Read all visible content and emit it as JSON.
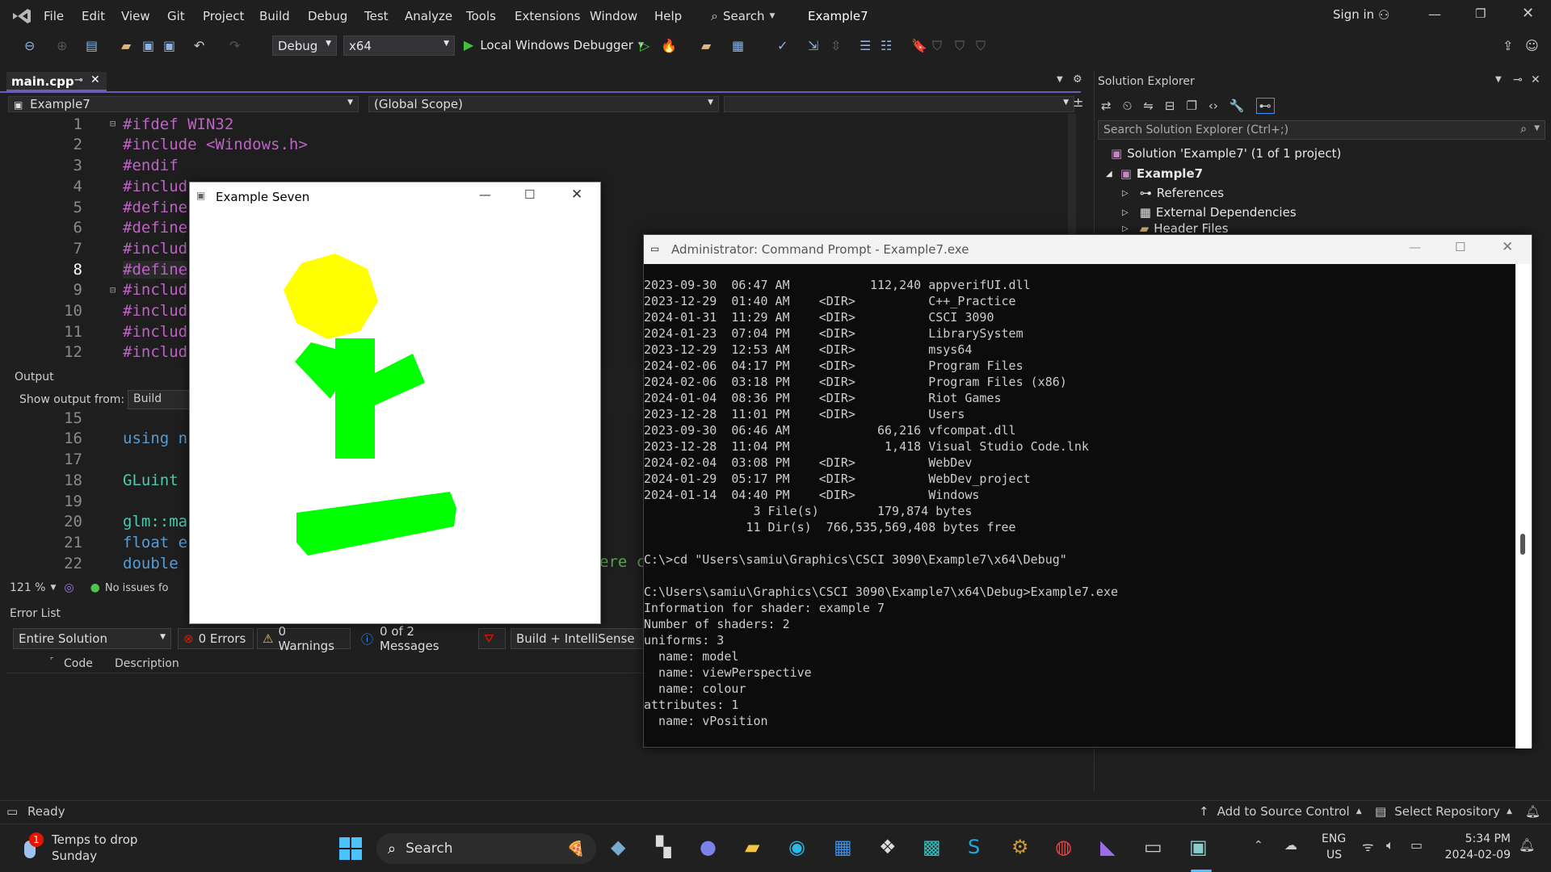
{
  "menu": {
    "items": [
      "File",
      "Edit",
      "View",
      "Git",
      "Project",
      "Build",
      "Debug",
      "Test",
      "Analyze",
      "Tools",
      "Extensions",
      "Window",
      "Help"
    ],
    "search_label": "Search",
    "solution_name": "Example7",
    "signin": "Sign in"
  },
  "toolbar": {
    "config": "Debug",
    "platform": "x64",
    "debugger": "Local Windows Debugger"
  },
  "editor": {
    "tab_label": "main.cpp",
    "nav_project": "Example7",
    "nav_scope": "(Global Scope)",
    "lines": [
      {
        "n": "1",
        "text": "#ifdef WIN32"
      },
      {
        "n": "2",
        "text": "#include <Windows.h>"
      },
      {
        "n": "3",
        "text": "#endif"
      },
      {
        "n": "4",
        "text": "#includ"
      },
      {
        "n": "5",
        "text": "#define"
      },
      {
        "n": "6",
        "text": "#define"
      },
      {
        "n": "7",
        "text": "#includ"
      },
      {
        "n": "8",
        "text": "#define"
      },
      {
        "n": "9",
        "text": "#includ"
      },
      {
        "n": "10",
        "text": "#includ"
      },
      {
        "n": "11",
        "text": "#includ"
      },
      {
        "n": "12",
        "text": "#includ"
      }
    ],
    "lines2": [
      {
        "n": "15",
        "text": ""
      },
      {
        "n": "16",
        "text": "using n"
      },
      {
        "n": "17",
        "text": ""
      },
      {
        "n": "18",
        "text": "GLuint"
      },
      {
        "n": "19",
        "text": ""
      },
      {
        "n": "20",
        "text": "glm::ma"
      },
      {
        "n": "21",
        "text": "float e"
      },
      {
        "n": "22",
        "text": "double"
      }
    ],
    "frag_comment": "ere c",
    "zoom": "121 %",
    "issues": "No issues fo"
  },
  "output": {
    "title": "Output",
    "show_from_label": "Show output from:",
    "show_from_value": "Build"
  },
  "errors": {
    "title": "Error List",
    "scope": "Entire Solution",
    "errors_btn": "0 Errors",
    "warnings_btn": "0 Warnings",
    "messages_btn": "0 of 2 Messages",
    "build_filter": "Build + IntelliSense",
    "col_code": "Code",
    "col_desc": "Description"
  },
  "solution": {
    "title": "Solution Explorer",
    "search_placeholder": "Search Solution Explorer (Ctrl+;)",
    "root": "Solution 'Example7' (1 of 1 project)",
    "project": "Example7",
    "items": [
      "References",
      "External Dependencies",
      "Header Files"
    ]
  },
  "status": {
    "ready": "Ready",
    "source_control": "Add to Source Control",
    "repo": "Select Repository"
  },
  "glwindow": {
    "title": "Example Seven",
    "head_color": "#ffff00",
    "body_color": "#00ff00"
  },
  "console": {
    "title": "Administrator: Command Prompt - Example7.exe",
    "lines": [
      "2023-09-30  06:47 AM           112,240 appverifUI.dll",
      "2023-12-29  01:40 AM    <DIR>          C++_Practice",
      "2024-01-31  11:29 AM    <DIR>          CSCI 3090",
      "2024-01-23  07:04 PM    <DIR>          LibrarySystem",
      "2023-12-29  12:53 AM    <DIR>          msys64",
      "2024-02-06  04:17 PM    <DIR>          Program Files",
      "2024-02-06  03:18 PM    <DIR>          Program Files (x86)",
      "2024-01-04  08:36 PM    <DIR>          Riot Games",
      "2023-12-28  11:01 PM    <DIR>          Users",
      "2023-09-30  06:46 AM            66,216 vfcompat.dll",
      "2023-12-28  11:04 PM             1,418 Visual Studio Code.lnk",
      "2024-02-04  03:08 PM    <DIR>          WebDev",
      "2024-01-29  05:17 PM    <DIR>          WebDev_project",
      "2024-01-14  04:40 PM    <DIR>          Windows",
      "               3 File(s)        179,874 bytes",
      "              11 Dir(s)  766,535,569,408 bytes free",
      "",
      "C:\\>cd \"Users\\samiu\\Graphics\\CSCI 3090\\Example7\\x64\\Debug\"",
      "",
      "C:\\Users\\samiu\\Graphics\\CSCI 3090\\Example7\\x64\\Debug>Example7.exe",
      "Information for shader: example 7",
      "Number of shaders: 2",
      "uniforms: 3",
      "  name: model",
      "  name: viewPerspective",
      "  name: colour",
      "attributes: 1",
      "  name: vPosition"
    ]
  },
  "taskbar": {
    "weather_line1": "Temps to drop",
    "weather_line2": "Sunday",
    "search": "Search",
    "lang1": "ENG",
    "lang2": "US",
    "time": "5:34 PM",
    "date": "2024-02-09"
  }
}
